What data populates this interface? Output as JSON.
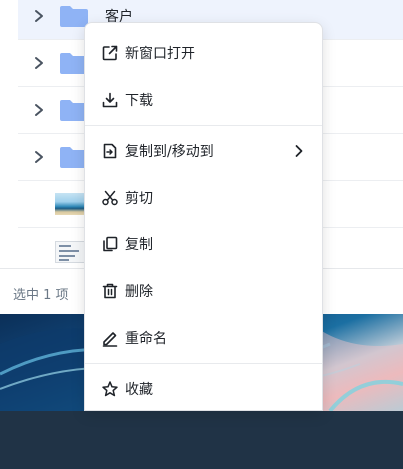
{
  "file_list": {
    "rows": [
      {
        "name": "客户",
        "kind": "folder",
        "icon": "folder-icon",
        "expand_icon": "chevron-right-icon",
        "hovered": true
      },
      {
        "name": "",
        "kind": "folder",
        "icon": "folder-icon",
        "expand_icon": "chevron-right-icon",
        "hovered": false
      },
      {
        "name": "",
        "kind": "folder",
        "icon": "folder-icon",
        "expand_icon": "chevron-right-icon",
        "hovered": false
      },
      {
        "name": "",
        "kind": "folder",
        "icon": "folder-icon",
        "expand_icon": "chevron-right-icon",
        "hovered": false
      },
      {
        "name": "",
        "kind": "image",
        "icon": "image-thumbnail-icon",
        "hovered": false
      },
      {
        "name": "",
        "kind": "image",
        "icon": "image-thumbnail-icon",
        "hovered": false
      }
    ]
  },
  "selection_bar": {
    "count_text": "选中 1 项"
  },
  "context_menu": {
    "items": [
      {
        "label": "新窗口打开",
        "icon": "open-external-icon"
      },
      {
        "label": "下载",
        "icon": "download-icon"
      },
      {
        "label": "复制到/移动到",
        "icon": "copy-move-icon",
        "submenu_icon": "chevron-right-icon"
      },
      {
        "label": "剪切",
        "icon": "scissors-icon"
      },
      {
        "label": "复制",
        "icon": "copy-icon"
      },
      {
        "label": "删除",
        "icon": "trash-icon"
      },
      {
        "label": "重命名",
        "icon": "pencil-icon"
      },
      {
        "label": "收藏",
        "icon": "star-icon"
      }
    ]
  },
  "colors": {
    "folder": "#8fb3f5",
    "row_hover": "#eef3fd",
    "taskbar": "#203346",
    "menu_border": "#dfe1e5"
  }
}
